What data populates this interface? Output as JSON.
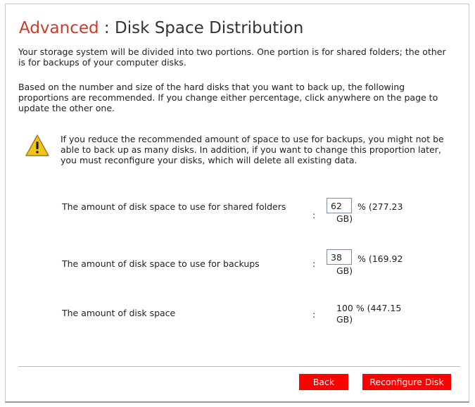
{
  "header": {
    "title_section": "Advanced",
    "title_separator": " : ",
    "title_page": "Disk Space Distribution"
  },
  "intro": {
    "paragraph1": "Your storage system will be divided into two portions. One portion is for shared folders; the other is for backups of your computer disks.",
    "paragraph2": "Based on the number and size of the hard disks that you want to back up, the following proportions are recommended. If you change either percentage, click anywhere on the page to update the other one."
  },
  "warning": {
    "icon": "warning-triangle-icon",
    "text": "If you reduce the recommended amount of space to use for backups, you might not be able to back up as many disks. In addition, if you want to change this proportion later, you must reconfigure your disks, which will delete all existing data."
  },
  "distribution": {
    "shared": {
      "label": "The amount of disk space to use for shared folders",
      "colon": ":",
      "percent_value": "62",
      "unit_text": "% (277.23",
      "gb_text": "GB)"
    },
    "backups": {
      "label": "The amount of disk space to use for backups",
      "colon": ":",
      "percent_value": "38",
      "unit_text": "% (169.92",
      "gb_text": "GB)"
    },
    "total": {
      "label": "The amount of disk space",
      "colon": ":",
      "value_text": "100 % (447.15",
      "gb_text": "GB)"
    }
  },
  "footer": {
    "back_label": "Back",
    "reconfigure_label": "Reconfigure Disk"
  },
  "colors": {
    "accent": "#cc3a2b",
    "button": "#ff0000",
    "warning": "#f0c419"
  }
}
